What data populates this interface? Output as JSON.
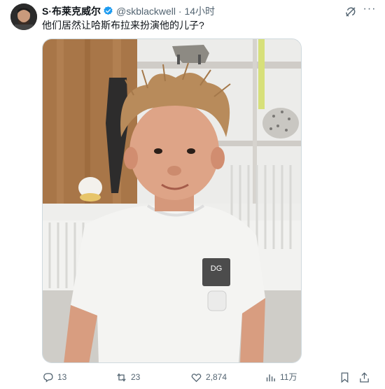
{
  "tweet": {
    "author_name": "S·布莱克威尔",
    "handle": "@skblackwell",
    "separator": "·",
    "time": "14小时",
    "text": "他们居然让哈斯布拉来扮演他的儿子?",
    "more_label": "···"
  },
  "actions": {
    "replies": "13",
    "reposts": "23",
    "likes": "2,874",
    "views": "11万"
  },
  "icons": {
    "verified": "verified-badge-icon",
    "grok": "grok-icon",
    "more": "more-icon",
    "reply": "reply-icon",
    "repost": "repost-icon",
    "like": "like-icon",
    "views": "views-icon",
    "bookmark": "bookmark-icon",
    "share": "share-icon"
  },
  "colors": {
    "verified": "#1d9bf0",
    "text": "#0f1419",
    "muted": "#536471"
  },
  "media": {
    "shirt_logo": "DG"
  }
}
